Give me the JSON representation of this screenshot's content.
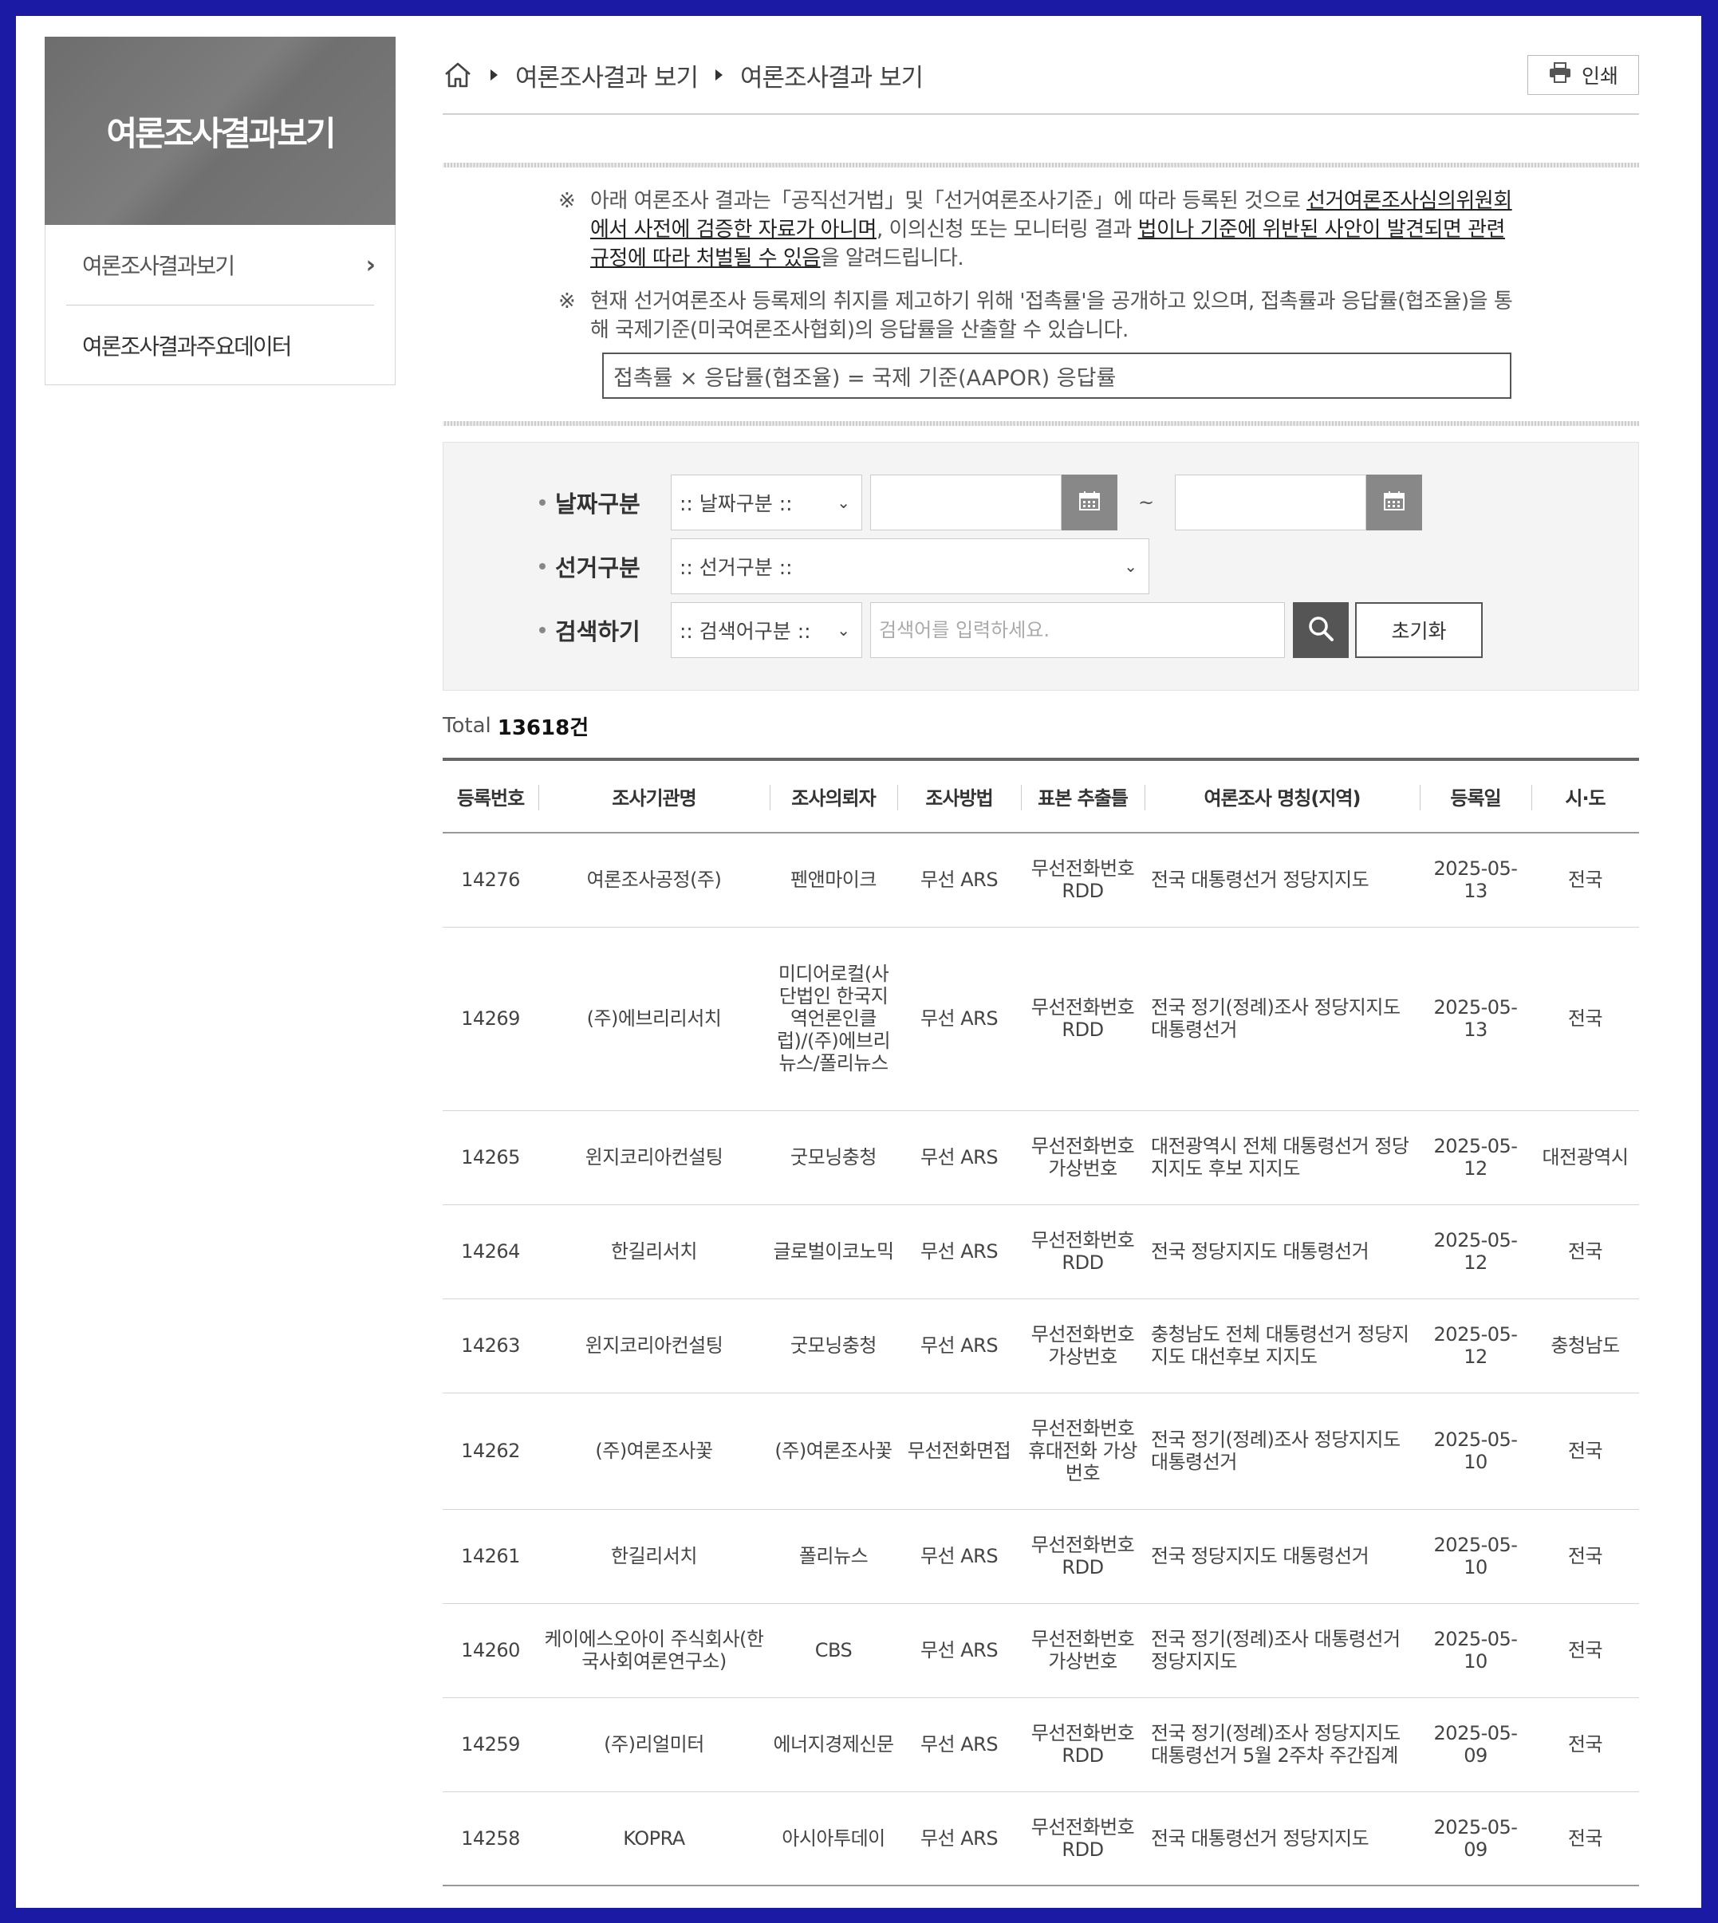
{
  "sidebar": {
    "title": "여론조사결과보기",
    "items": [
      {
        "label": "여론조사결과보기"
      },
      {
        "label": "여론조사결과주요데이터"
      }
    ]
  },
  "breadcrumb": {
    "items": [
      "여론조사결과 보기",
      "여론조사결과 보기"
    ]
  },
  "print_label": "인쇄",
  "notice": {
    "mark": "※",
    "line1_a": "아래 여론조사 결과는「공직선거법」및「선거여론조사기준」에 따라 등록된 것으로 ",
    "line1_u1": "선거여론조사심의위원회에서 사전에 검증한 자료가 아니며",
    "line1_b": ", 이의신청 또는 모니터링 결과 ",
    "line1_u2": "법이나 기준에 위반된 사안이 발견되면 관련 규정에 따라 처벌될 수 있음",
    "line1_c": "을 알려드립니다.",
    "line2": "현재 선거여론조사 등록제의 취지를 제고하기 위해 '접촉률'을 공개하고 있으며, 접촉률과 응답률(협조율)을 통해 국제기준(미국여론조사협회)의 응답률을 산출할 수 있습니다.",
    "formula": "접촉률 × 응답률(협조율) = 국제 기준(AAPOR) 응답률"
  },
  "search": {
    "date_label": "날짜구분",
    "date_select": ":: 날짜구분 ::",
    "tilde": "~",
    "election_label": "선거구분",
    "election_select": ":: 선거구분 ::",
    "keyword_label": "검색하기",
    "keyword_select": ":: 검색어구분 ::",
    "keyword_placeholder": "검색어를 입력하세요.",
    "reset_label": "초기화"
  },
  "total": {
    "prefix": "Total",
    "count": "13618건"
  },
  "table": {
    "headers": [
      "등록번호",
      "조사기관명",
      "조사의뢰자",
      "조사방법",
      "표본 추출틀",
      "여론조사 명칭(지역)",
      "등록일",
      "시·도"
    ],
    "rows": [
      {
        "no": "14276",
        "org": "여론조사공정(주)",
        "client": "펜앤마이크",
        "method": "무선 ARS",
        "frame": "무선전화번호 RDD",
        "title": "전국 대통령선거 정당지지도",
        "date": "2025-05-13",
        "region": "전국"
      },
      {
        "no": "14269",
        "org": "(주)에브리리서치",
        "client": "미디어로컬(사단법인 한국지역언론인클럽)/(주)에브리뉴스/폴리뉴스",
        "method": "무선 ARS",
        "frame": "무선전화번호 RDD",
        "title": "전국 정기(정례)조사 정당지지도 대통령선거",
        "date": "2025-05-13",
        "region": "전국"
      },
      {
        "no": "14265",
        "org": "윈지코리아컨설팅",
        "client": "굿모닝충청",
        "method": "무선 ARS",
        "frame": "무선전화번호 가상번호",
        "title": "대전광역시 전체 대통령선거 정당지지도 후보 지지도",
        "date": "2025-05-12",
        "region": "대전광역시"
      },
      {
        "no": "14264",
        "org": "한길리서치",
        "client": "글로벌이코노믹",
        "method": "무선 ARS",
        "frame": "무선전화번호 RDD",
        "title": "전국 정당지지도 대통령선거",
        "date": "2025-05-12",
        "region": "전국"
      },
      {
        "no": "14263",
        "org": "윈지코리아컨설팅",
        "client": "굿모닝충청",
        "method": "무선 ARS",
        "frame": "무선전화번호 가상번호",
        "title": "충청남도 전체 대통령선거 정당지지도 대선후보 지지도",
        "date": "2025-05-12",
        "region": "충청남도"
      },
      {
        "no": "14262",
        "org": "(주)여론조사꽃",
        "client": "(주)여론조사꽃",
        "method": "무선전화면접",
        "frame": "무선전화번호 휴대전화 가상번호",
        "title": "전국 정기(정례)조사 정당지지도 대통령선거",
        "date": "2025-05-10",
        "region": "전국"
      },
      {
        "no": "14261",
        "org": "한길리서치",
        "client": "폴리뉴스",
        "method": "무선 ARS",
        "frame": "무선전화번호 RDD",
        "title": "전국 정당지지도 대통령선거",
        "date": "2025-05-10",
        "region": "전국"
      },
      {
        "no": "14260",
        "org": "케이에스오아이 주식회사(한국사회여론연구소)",
        "client": "CBS",
        "method": "무선 ARS",
        "frame": "무선전화번호 가상번호",
        "title": "전국 정기(정례)조사 대통령선거 정당지지도",
        "date": "2025-05-10",
        "region": "전국"
      },
      {
        "no": "14259",
        "org": "(주)리얼미터",
        "client": "에너지경제신문",
        "method": "무선 ARS",
        "frame": "무선전화번호 RDD",
        "title": "전국 정기(정례)조사 정당지지도 대통령선거 5월 2주차 주간집계",
        "date": "2025-05-09",
        "region": "전국"
      },
      {
        "no": "14258",
        "org": "KOPRA",
        "client": "아시아투데이",
        "method": "무선 ARS",
        "frame": "무선전화번호 RDD",
        "title": "전국 대통령선거 정당지지도",
        "date": "2025-05-09",
        "region": "전국"
      }
    ]
  }
}
